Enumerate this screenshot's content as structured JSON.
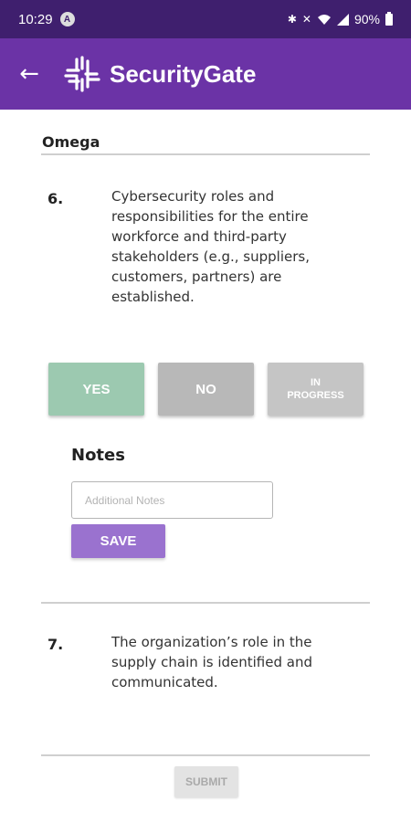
{
  "status_bar": {
    "time": "10:29",
    "notification_glyph": "A",
    "icons": [
      "bluetooth-icon",
      "mute-icon",
      "wifi-icon",
      "signal-icon"
    ],
    "battery": "90%"
  },
  "app_bar": {
    "title": "SecurityGate",
    "back_icon": "arrow-left-icon",
    "logo_icon": "securitygate-logo-icon",
    "color": "#6b33a6"
  },
  "section": {
    "title": "Omega"
  },
  "questions": [
    {
      "number": "6.",
      "text": "Cybersecurity roles and responsibilities for the entire workforce and third-party stakeholders (e.g., suppliers, customers, partners) are established."
    },
    {
      "number": "7.",
      "text": "The organization’s role in the supply chain is identified and communicated."
    }
  ],
  "answers": {
    "yes": "YES",
    "no": "NO",
    "in_progress": "IN\nPROGRESS",
    "yes_color": "#9cc9b0",
    "no_color": "#b8b8b8"
  },
  "notes": {
    "heading": "Notes",
    "placeholder": "Additional Notes",
    "value": "",
    "save_label": "SAVE"
  },
  "footer": {
    "submit_label": "SUBMIT"
  }
}
